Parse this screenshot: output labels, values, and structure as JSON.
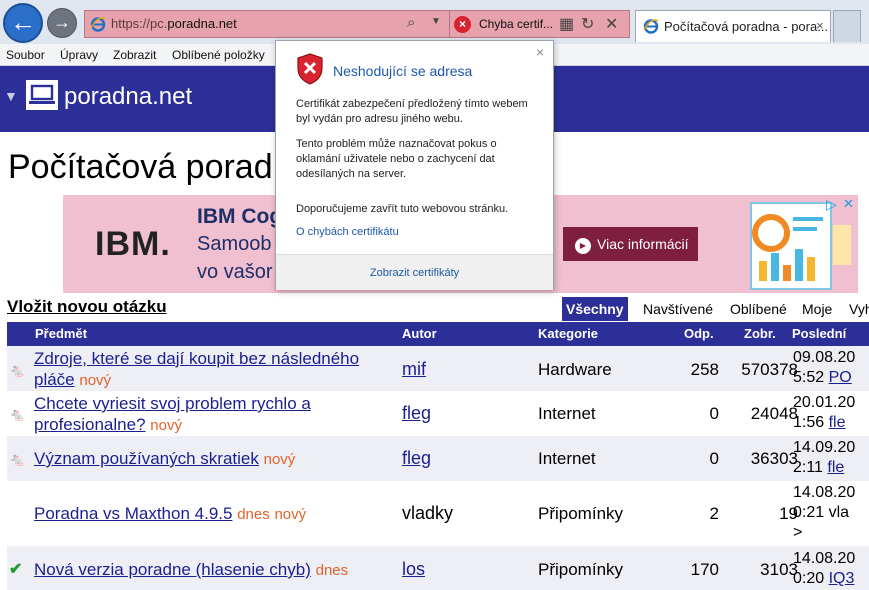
{
  "browser": {
    "address_url_prefix": "https://pc.",
    "address_url_domain": "poradna.net",
    "cert_warning_label": "Chyba certif...",
    "tab_title": "Počítačová poradna - pora...",
    "tab_close": "×"
  },
  "menu": {
    "items": [
      "Soubor",
      "Úpravy",
      "Zobrazit",
      "Oblíbené položky"
    ]
  },
  "site": {
    "brand": "poradna.net",
    "page_title": "Počítačová poradna"
  },
  "ad": {
    "logo": "IBM.",
    "headline": "IBM Cog",
    "line2": "Samoob",
    "line3": "vo vašor",
    "cta": "Viac informácií"
  },
  "actions": {
    "new_question": "Vložit novou otázku"
  },
  "filters": [
    "Všechny",
    "Navštívené",
    "Oblíbené",
    "Moje",
    "Vyh"
  ],
  "table": {
    "headers": {
      "subject": "Předmět",
      "author": "Autor",
      "category": "Kategorie",
      "answers": "Odp.",
      "views": "Zobr.",
      "last": "Poslední"
    },
    "rows": [
      {
        "icon": "mouse-icon",
        "subject": "Zdroje, které se dají koupit bez následného pláče",
        "tags": [
          "nový"
        ],
        "author": "mif",
        "author_is_link": true,
        "category": "Hardware",
        "answers": "258",
        "views": "570378",
        "last_date": "09.08.20",
        "last_time": "5:52",
        "last_user": "PO"
      },
      {
        "icon": "mouse-icon",
        "subject": "Chcete vyriesit svoj problem rychlo a profesionalne?",
        "tags": [
          "nový"
        ],
        "author": "fleg",
        "author_is_link": true,
        "category": "Internet",
        "answers": "0",
        "views": "24048",
        "last_date": "20.01.20",
        "last_time": "1:56",
        "last_user": "fle"
      },
      {
        "icon": "mouse-icon",
        "subject": "Význam používaných skratiek",
        "tags": [
          "nový"
        ],
        "author": "fleg",
        "author_is_link": true,
        "category": "Internet",
        "answers": "0",
        "views": "36303",
        "last_date": "14.09.20",
        "last_time": "2:11",
        "last_user": "fle"
      },
      {
        "icon": "",
        "subject": "Poradna vs Maxthon 4.9.5",
        "tags": [
          "dnes",
          "nový"
        ],
        "author": "vladky",
        "author_is_link": false,
        "category": "Připomínky",
        "answers": "2",
        "views": "19",
        "last_date": "14.08.20",
        "last_time": "0:21",
        "last_user": "vla",
        "last_extra": ">"
      },
      {
        "icon": "check-icon",
        "subject": "Nová verzia poradne (hlasenie chyb)",
        "tags": [
          "dnes"
        ],
        "author": "los",
        "author_is_link": true,
        "category": "Připomínky",
        "answers": "170",
        "views": "3103",
        "last_date": "14.08.20",
        "last_time": "0:20",
        "last_user": "IQ3"
      }
    ]
  },
  "popup": {
    "title": "Neshodující se adresa",
    "close": "×",
    "p1": "Certifikát zabezpečení předložený tímto webem byl vydán pro adresu jiného webu.",
    "p2": "Tento problém může naznačovat pokus o oklamání uživatele nebo o zachycení dat odesílaných na server.",
    "p3": "Doporučujeme zavřít tuto webovou stránku.",
    "link": "O chybách certifikátu",
    "footer_link": "Zobrazit certifikáty"
  },
  "colors": {
    "site_blue": "#2c2f98",
    "link_blue": "#1a1f8f",
    "tag_orange": "#e3632b",
    "address_error": "#e6a2ad",
    "ad_bg": "#f0bfd0",
    "cta": "#7e1f3f"
  }
}
